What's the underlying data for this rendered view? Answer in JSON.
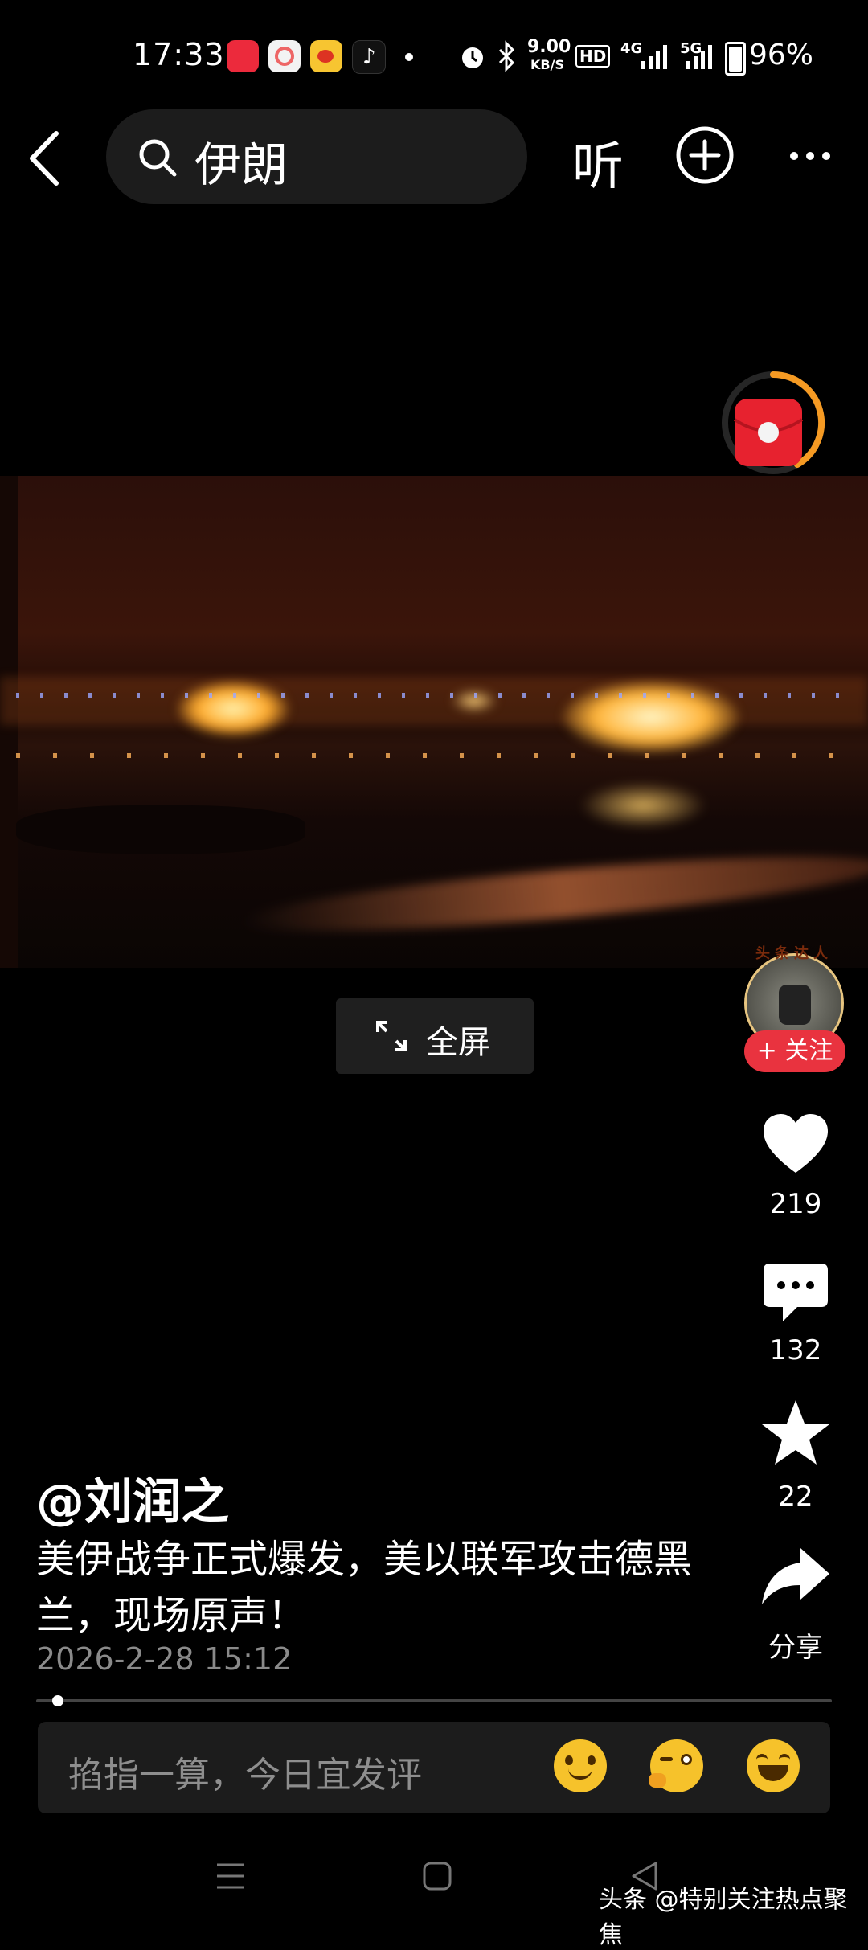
{
  "status_bar": {
    "time": "17:33",
    "network_speed": "9.00",
    "network_speed_unit": "KB/S",
    "hd_badge": "HD",
    "signal_1": "4G",
    "signal_2": "5G",
    "battery": "96%",
    "app_icons": [
      "music-app-icon",
      "photos-app-icon",
      "weibo-icon",
      "tiktok-icon"
    ],
    "icons": [
      "alarm-icon",
      "bluetooth-icon",
      "signal-icon",
      "battery-icon"
    ]
  },
  "top_bar": {
    "search_query": "伊朗",
    "listen_label": "听",
    "icons": [
      "back-icon",
      "search-icon",
      "add-icon",
      "more-icon"
    ]
  },
  "video": {
    "fullscreen_label": "全屏"
  },
  "side_rail": {
    "badge_text": "头条达人",
    "follow_label": "+ 关注",
    "like_count": "219",
    "comment_count": "132",
    "favorite_count": "22",
    "share_label": "分享",
    "icons": [
      "red-envelope-icon",
      "heart-icon",
      "comment-icon",
      "star-icon",
      "share-icon"
    ]
  },
  "caption": {
    "author": "@刘润之",
    "description": "美伊战争正式爆发，美以联军攻击德黑兰，现场原声！",
    "date": "2026-2-28 15:12"
  },
  "comment_bar": {
    "placeholder": "掐指一算，今日宜发评",
    "emojis": [
      "smile-emoji-icon",
      "thinking-emoji-icon",
      "laugh-emoji-icon"
    ]
  },
  "nav": {
    "icons": [
      "menu-nav-icon",
      "home-nav-icon",
      "back-nav-icon"
    ]
  },
  "watermark": "头条 @特别关注热点聚焦",
  "colors": {
    "accent_red": "#e9333f",
    "progress_orange": "#f59a23",
    "background": "#000000"
  }
}
